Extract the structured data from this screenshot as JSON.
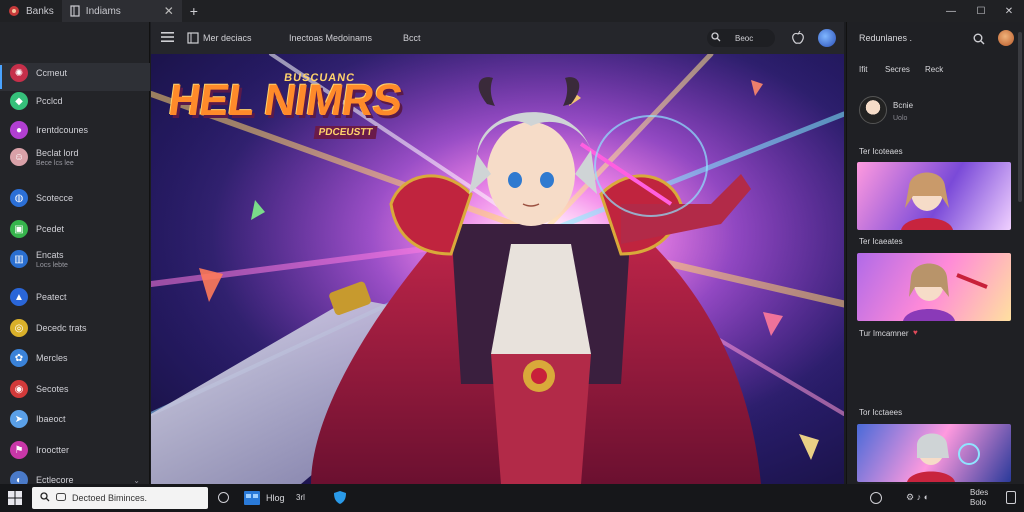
{
  "tabs": [
    {
      "label": "Banks",
      "icon": "app-logo-icon"
    },
    {
      "label": "Indiams",
      "icon": "folder-icon"
    }
  ],
  "window_controls": [
    "minimize-icon",
    "maximize-icon",
    "close-icon"
  ],
  "sidebar": {
    "items": [
      {
        "label": "Ccmeut",
        "sub": "",
        "icon": "pinwheel-icon",
        "color": "#c62f4a"
      },
      {
        "label": "Pcclcd",
        "sub": "",
        "icon": "gem-icon",
        "color": "#35c07a"
      },
      {
        "label": "Irentdcounes",
        "sub": "",
        "icon": "orb-icon",
        "color": "#b13fd1"
      },
      {
        "label": "Beclat lord",
        "sub": "Bece lcs lee",
        "icon": "character-icon",
        "color": "#d9a1a8"
      },
      {
        "label": "Scotecce",
        "sub": "",
        "icon": "globe-icon",
        "color": "#2b6fd6"
      },
      {
        "label": "Pcedet",
        "sub": "",
        "icon": "puzzle-icon",
        "color": "#36b44c"
      },
      {
        "label": "Encats",
        "sub": "Locs lebte",
        "icon": "chart-icon",
        "color": "#2a6fd0"
      },
      {
        "label": "Peatect",
        "sub": "",
        "icon": "shield-icon",
        "color": "#2a66d8"
      },
      {
        "label": "Decedc trats",
        "sub": "",
        "icon": "ring-icon",
        "color": "#d9b02a"
      },
      {
        "label": "Mercles",
        "sub": "",
        "icon": "colorwheel-icon",
        "color": "#3a82d8"
      },
      {
        "label": "Secotes",
        "sub": "",
        "icon": "record-icon",
        "color": "#d23a3a"
      },
      {
        "label": "Ibaeoct",
        "sub": "",
        "icon": "rocket-icon",
        "color": "#5aa0e8"
      },
      {
        "label": "Irooctter",
        "sub": "",
        "icon": "flag-icon",
        "color": "#c837a8"
      },
      {
        "label": "Ectlecore",
        "sub": "",
        "icon": "planet-icon",
        "color": "#4a7ac8"
      }
    ]
  },
  "toolbar": {
    "menu_icon": "hamburger-icon",
    "items": [
      "Mer deciacs",
      "Inectoas Medoinams",
      "Bcct"
    ],
    "search_icon": "search-icon",
    "search_text": "Beoc",
    "apple_icon": "apple-icon",
    "profile_icon": "avatar-icon"
  },
  "hero": {
    "logo_main": "HEL NIMRS",
    "logo_top": "BUSCUANC",
    "logo_sub": "PDCEUSTT"
  },
  "right_panel": {
    "title": "Redunlanes .",
    "tabs": [
      "Ifit",
      "Secres",
      "Reck"
    ],
    "profile": {
      "name": "Bcnie",
      "sub": "Uolo"
    },
    "cards": [
      {
        "caption": "Ter Icoteaes"
      },
      {
        "caption": "Ter Icaeates"
      },
      {
        "caption": "Tur Imcamner"
      },
      {
        "caption": "Tor Icctaees"
      }
    ]
  },
  "taskbar": {
    "search_text": "Dectoed Biminces.",
    "apps": [
      "Hlog",
      "3rl"
    ],
    "tray": [
      "Bdes",
      "Bolo"
    ]
  }
}
